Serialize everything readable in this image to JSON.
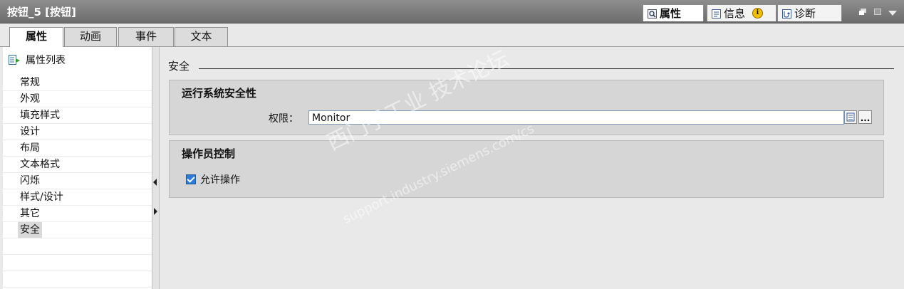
{
  "window": {
    "title": "按钮_5 [按钮]"
  },
  "panel_tabs": [
    {
      "label": "属性",
      "icon": "inspect-icon"
    },
    {
      "label": "信息",
      "icon": "info-list-icon"
    },
    {
      "label": "诊断",
      "icon": "diagnostics-icon"
    }
  ],
  "tabs": [
    "属性",
    "动画",
    "事件",
    "文本"
  ],
  "sidebar": {
    "header": "属性列表",
    "items": [
      "常规",
      "外观",
      "填充样式",
      "设计",
      "布局",
      "文本格式",
      "闪烁",
      "样式/设计",
      "其它",
      "安全"
    ],
    "selected": "安全"
  },
  "main": {
    "section_title": "安全",
    "runtime_security": {
      "title": "运行系统安全性",
      "permission_label": "权限：",
      "permission_value": "Monitor"
    },
    "operator_control": {
      "title": "操作员控制",
      "allow_operation_label": "允许操作",
      "allow_operation_checked": true
    }
  },
  "watermark": {
    "line1": "西门子工业 技术论坛",
    "line2": "support.industry.siemens.com/cs"
  },
  "colors": {
    "title_bar": "#7a7a7a",
    "checkbox": "#2e7bd6",
    "info_badge": "#f0c000"
  }
}
